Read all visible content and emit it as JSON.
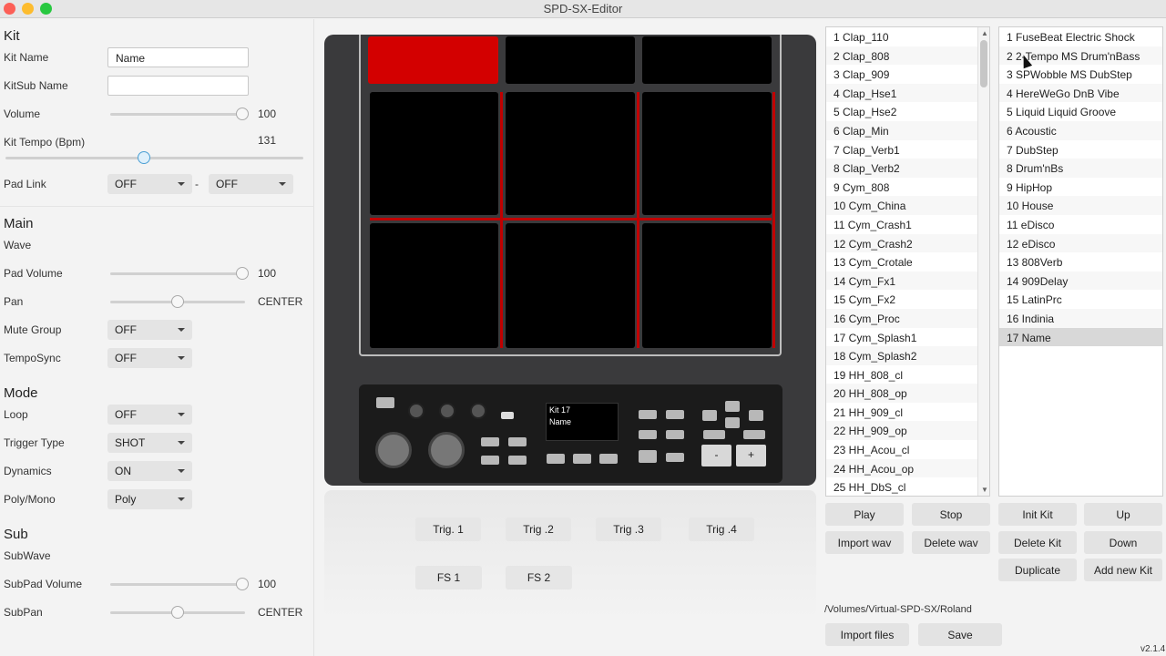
{
  "window": {
    "title": "SPD-SX-Editor"
  },
  "kit": {
    "heading": "Kit",
    "kit_name_label": "Kit Name",
    "kit_name_value": "Name",
    "kitsub_name_label": "KitSub Name",
    "kitsub_name_value": "",
    "volume_label": "Volume",
    "volume_value": "100",
    "volume_level": 1.0,
    "tempo_label": "Kit Tempo (Bpm)",
    "tempo_value": "131",
    "pad_link_label": "Pad Link",
    "pad_link_a": "OFF",
    "pad_link_sep": "-",
    "pad_link_b": "OFF"
  },
  "main": {
    "heading": "Main",
    "wave_label": "Wave",
    "pad_volume_label": "Pad Volume",
    "pad_volume_value": "100",
    "pan_label": "Pan",
    "pan_value": "CENTER",
    "mute_group_label": "Mute Group",
    "mute_group_value": "OFF",
    "temposync_label": "TempoSync",
    "temposync_value": "OFF"
  },
  "mode": {
    "heading": "Mode",
    "loop_label": "Loop",
    "loop_value": "OFF",
    "trigger_type_label": "Trigger Type",
    "trigger_type_value": "SHOT",
    "dynamics_label": "Dynamics",
    "dynamics_value": "ON",
    "polymono_label": "Poly/Mono",
    "polymono_value": "Poly"
  },
  "sub": {
    "heading": "Sub",
    "subwave_label": "SubWave",
    "subpad_volume_label": "SubPad Volume",
    "subpad_volume_value": "100",
    "subpan_label": "SubPan",
    "subpan_value": "CENTER"
  },
  "device": {
    "display_line1": "Kit 17",
    "display_line2": "Name",
    "minus": "-",
    "plus": "+"
  },
  "triggers": [
    "Trig. 1",
    "Trig .2",
    "Trig .3",
    "Trig .4"
  ],
  "footswitches": [
    "FS 1",
    "FS 2"
  ],
  "waves": [
    "1 Clap_110",
    "2 Clap_808",
    "3 Clap_909",
    "4 Clap_Hse1",
    "5 Clap_Hse2",
    "6 Clap_Min",
    "7 Clap_Verb1",
    "8 Clap_Verb2",
    "9 Cym_808",
    "10 Cym_China",
    "11 Cym_Crash1",
    "12 Cym_Crash2",
    "13 Cym_Crotale",
    "14 Cym_Fx1",
    "15 Cym_Fx2",
    "16 Cym_Proc",
    "17 Cym_Splash1",
    "18 Cym_Splash2",
    "19 HH_808_cl",
    "20 HH_808_op",
    "21 HH_909_cl",
    "22 HH_909_op",
    "23 HH_Acou_cl",
    "24 HH_Acou_op",
    "25 HH_DbS_cl"
  ],
  "kits": [
    "1 FuseBeat Electric Shock",
    "2 2-Tempo MS Drum'nBass",
    "3 SPWobble MS DubStep",
    "4 HereWeGo DnB Vibe",
    "5 Liquid Liquid Groove",
    "6 Acoustic",
    "7 DubStep",
    "8 Drum'nBs",
    "9 HipHop",
    "10 House",
    "11 eDisco",
    "12 eDisco",
    "13 808Verb",
    "14 909Delay",
    "15 LatinPrc",
    "16 Indinia",
    "17 Name"
  ],
  "buttons": {
    "play": "Play",
    "stop": "Stop",
    "import_wav": "Import wav",
    "delete_wav": "Delete wav",
    "init_kit": "Init Kit",
    "up": "Up",
    "delete_kit": "Delete Kit",
    "down": "Down",
    "duplicate": "Duplicate",
    "add_new_kit": "Add new Kit",
    "import_files": "Import files",
    "save": "Save"
  },
  "path": "/Volumes/Virtual-SPD-SX/Roland",
  "version": "v2.1.4"
}
